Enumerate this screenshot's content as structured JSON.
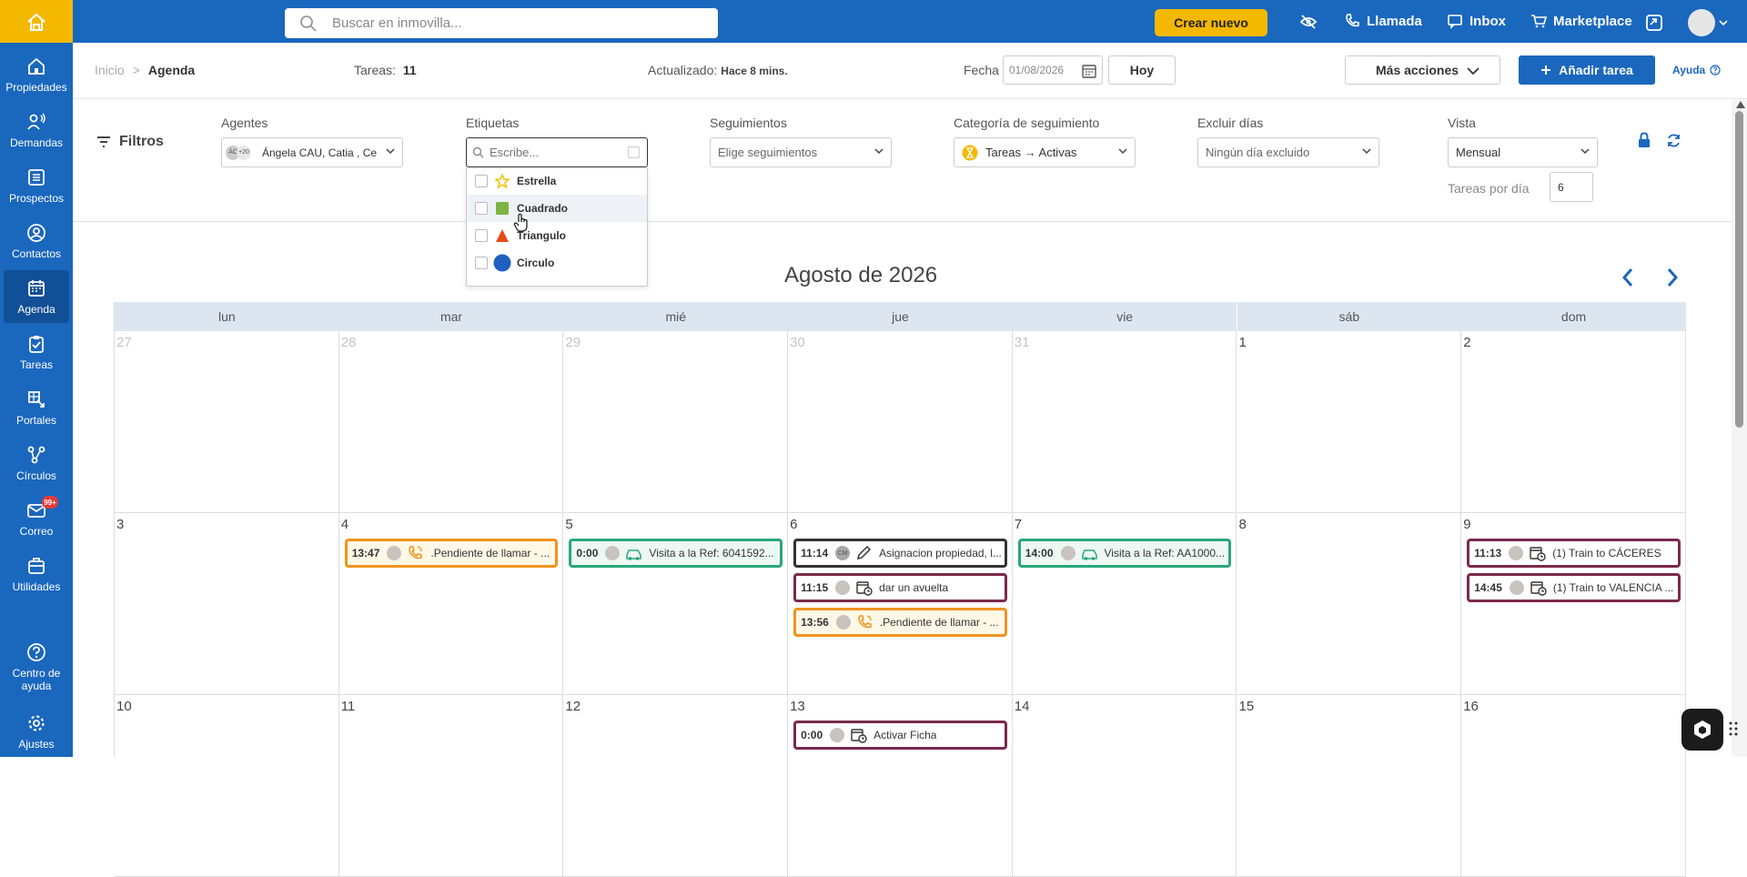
{
  "topbar": {
    "search_placeholder": "Buscar en inmovilla...",
    "create_button": "Crear nuevo",
    "nav": [
      "Llamada",
      "Inbox",
      "Marketplace"
    ]
  },
  "sidebar": {
    "items": [
      {
        "label": "Propiedades",
        "icon": "home-icon"
      },
      {
        "label": "Demandas",
        "icon": "person-wave-icon"
      },
      {
        "label": "Prospectos",
        "icon": "list-icon"
      },
      {
        "label": "Contactos",
        "icon": "user-circle-icon"
      },
      {
        "label": "Agenda",
        "icon": "calendar-icon",
        "active": true
      },
      {
        "label": "Tareas",
        "icon": "clipboard-icon"
      },
      {
        "label": "Portales",
        "icon": "portal-icon"
      },
      {
        "label": "Círculos",
        "icon": "network-icon"
      },
      {
        "label": "Correo",
        "icon": "mail-icon",
        "badge": "99+"
      },
      {
        "label": "Utilidades",
        "icon": "toolbox-icon"
      }
    ],
    "help": "Centro de ayuda",
    "settings": "Ajustes"
  },
  "subheader": {
    "breadcrumb_home": "Inicio",
    "breadcrumb_sep": ">",
    "breadcrumb_current": "Agenda",
    "tasks_label": "Tareas:",
    "tasks_count": "11",
    "updated_label": "Actualizado:",
    "updated_value": "Hace 8 mins.",
    "date_label": "Fecha",
    "date_value": "01/08/2026",
    "today_button": "Hoy",
    "more_actions": "Más acciones",
    "add_task": "Añadir tarea",
    "help": "Ayuda"
  },
  "filters": {
    "title": "Filtros",
    "agents_label": "Agentes",
    "agents_badge": "+20",
    "agents_avatar": "ÁC",
    "agents_value": "Ángela CAU, Catia , Ce",
    "tags_label": "Etiquetas",
    "tags_placeholder": "Escribe...",
    "followups_label": "Seguimientos",
    "followups_value": "Elige seguimientos",
    "category_label": "Categoría de seguimiento",
    "category_value": "Tareas → Activas",
    "exclude_label": "Excluir días",
    "exclude_value": "Ningún día excluido",
    "view_label": "Vista",
    "view_value": "Mensual",
    "tasks_per_day_label": "Tareas por día",
    "tasks_per_day_value": "6",
    "tag_options": [
      {
        "label": "Estrella",
        "icon": "star-icon",
        "color": "#f2c200"
      },
      {
        "label": "Cuadrado",
        "icon": "square-icon",
        "color": "#7cb342"
      },
      {
        "label": "Triangulo",
        "icon": "triangle-icon",
        "color": "#e64a19"
      },
      {
        "label": "Circulo",
        "icon": "circle-icon",
        "color": "#1f5fbf"
      }
    ]
  },
  "calendar": {
    "title": "Agosto de 2026",
    "days": [
      "lun",
      "mar",
      "mié",
      "jue",
      "vie",
      "sáb",
      "dom"
    ],
    "weeks": [
      [
        {
          "n": "27",
          "off": true
        },
        {
          "n": "28",
          "off": true
        },
        {
          "n": "29",
          "off": true
        },
        {
          "n": "30",
          "off": true
        },
        {
          "n": "31",
          "off": true
        },
        {
          "n": "1"
        },
        {
          "n": "2"
        }
      ],
      [
        {
          "n": "3"
        },
        {
          "n": "4"
        },
        {
          "n": "5"
        },
        {
          "n": "6"
        },
        {
          "n": "7"
        },
        {
          "n": "8"
        },
        {
          "n": "9"
        }
      ],
      [
        {
          "n": "10"
        },
        {
          "n": "11"
        },
        {
          "n": "12"
        },
        {
          "n": "13"
        },
        {
          "n": "14"
        },
        {
          "n": "15"
        },
        {
          "n": "16"
        }
      ]
    ],
    "events": [
      {
        "week": 1,
        "day": 1,
        "slot": 0,
        "time": "13:47",
        "icon": "phone-icon",
        "text": ".Pendiente de llamar - ...",
        "style": "orange"
      },
      {
        "week": 1,
        "day": 2,
        "slot": 0,
        "time": "0:00",
        "icon": "car-icon",
        "text": "Visita a la Ref: 6041592...",
        "style": "teal"
      },
      {
        "week": 1,
        "day": 3,
        "slot": 0,
        "time": "11:14",
        "icon": "pencil-icon",
        "text": "Asignacion propiedad, l...",
        "style": "dark",
        "avatar_text": "CM"
      },
      {
        "week": 1,
        "day": 3,
        "slot": 1,
        "time": "11:15",
        "icon": "calendar-clock-icon",
        "text": "dar un avuelta",
        "style": "maroon"
      },
      {
        "week": 1,
        "day": 3,
        "slot": 2,
        "time": "13:56",
        "icon": "phone-icon",
        "text": ".Pendiente de llamar - ...",
        "style": "orange"
      },
      {
        "week": 1,
        "day": 4,
        "slot": 0,
        "time": "14:00",
        "icon": "car-icon",
        "text": "Visita a la Ref: AA1000...",
        "style": "teal"
      },
      {
        "week": 1,
        "day": 6,
        "slot": 0,
        "time": "11:13",
        "icon": "calendar-clock-icon",
        "text": "(1) Train to CÁCERES",
        "style": "maroon"
      },
      {
        "week": 1,
        "day": 6,
        "slot": 1,
        "time": "14:45",
        "icon": "calendar-clock-icon",
        "text": "(1) Train to VALENCIA ...",
        "style": "maroon"
      },
      {
        "week": 2,
        "day": 3,
        "slot": 0,
        "time": "0:00",
        "icon": "calendar-clock-icon",
        "text": "Activar Ficha",
        "style": "maroon"
      }
    ]
  }
}
